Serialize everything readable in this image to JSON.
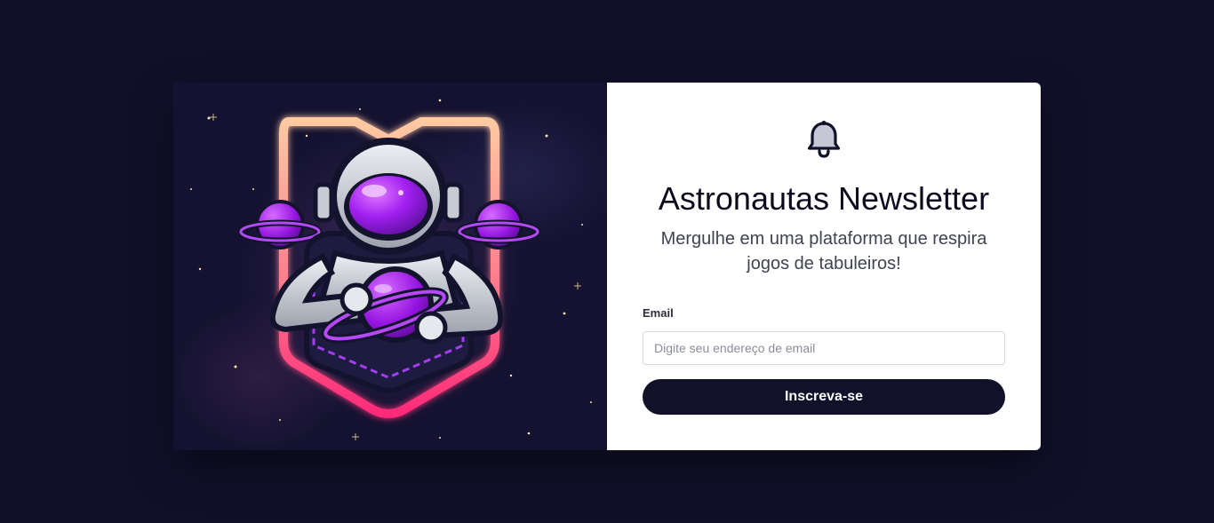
{
  "hero": {
    "image_name": "astronaut-mascot-logo",
    "colors": {
      "shield_top": "#ffc7a0",
      "shield_bottom": "#ff2f7a",
      "planet": "#9b1ee6",
      "suit": "#c9ccd3",
      "outline": "#14132e"
    }
  },
  "newsletter": {
    "icon": "bell-icon",
    "title": "Astronautas Newsletter",
    "subtitle": "Mergulhe em uma plataforma que respira jogos de tabuleiros!",
    "email_label": "Email",
    "email_placeholder": "Digite seu endereço de email",
    "email_value": "",
    "submit_label": "Inscreva-se"
  },
  "colors": {
    "page_background": "#11102a",
    "button_background": "#12112a",
    "panel_background": "#ffffff"
  }
}
